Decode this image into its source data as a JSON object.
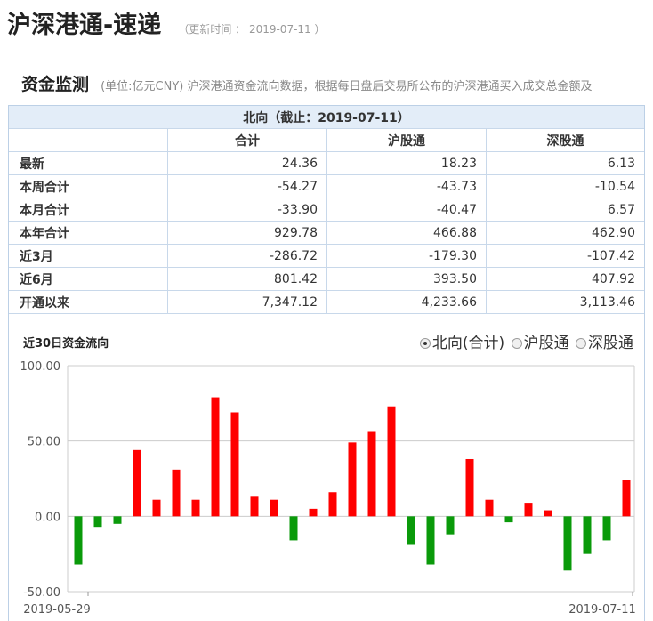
{
  "header": {
    "title": "沪深港通-速递",
    "update_info": "（更新时间 ： 2019-07-11 ）"
  },
  "section": {
    "title": "资金监测",
    "description": "(单位:亿元CNY)  沪深港通资金流向数据，根据每日盘后交易所公布的沪深港通买入成交总金额及"
  },
  "table": {
    "caption": "北向（截止：2019-07-11）",
    "columns": [
      "",
      "合计",
      "沪股通",
      "深股通"
    ],
    "rows": [
      [
        "最新",
        "24.36",
        "18.23",
        "6.13"
      ],
      [
        "本周合计",
        "-54.27",
        "-43.73",
        "-10.54"
      ],
      [
        "本月合计",
        "-33.90",
        "-40.47",
        "6.57"
      ],
      [
        "本年合计",
        "929.78",
        "466.88",
        "462.90"
      ],
      [
        "近3月",
        "-286.72",
        "-179.30",
        "-107.42"
      ],
      [
        "近6月",
        "801.42",
        "393.50",
        "407.92"
      ],
      [
        "开通以来",
        "7,347.12",
        "4,233.66",
        "3,113.46"
      ]
    ]
  },
  "chart_section": {
    "title": "近30日资金流向",
    "options": [
      {
        "label": "北向(合计)",
        "checked": true
      },
      {
        "label": "沪股通",
        "checked": false
      },
      {
        "label": "深股通",
        "checked": false
      }
    ]
  },
  "chart_data": {
    "type": "bar",
    "x_start_label": "2019-05-29",
    "x_end_label": "2019-07-11",
    "values": [
      -32,
      -7,
      -5,
      44,
      11,
      31,
      11,
      79,
      69,
      13,
      11,
      -16,
      5,
      16,
      49,
      56,
      73,
      -19,
      -32,
      -12,
      38,
      11,
      -4,
      9,
      4,
      -36,
      -25,
      -16,
      24
    ],
    "ylim": [
      -50,
      100
    ],
    "yticks": [
      100,
      50,
      0,
      -50
    ],
    "ytick_labels": [
      "100.00",
      "50.00",
      "0.00",
      "-50.00"
    ],
    "grid": true,
    "positive_color": "#ff0000",
    "negative_color": "#0a9a0a"
  }
}
